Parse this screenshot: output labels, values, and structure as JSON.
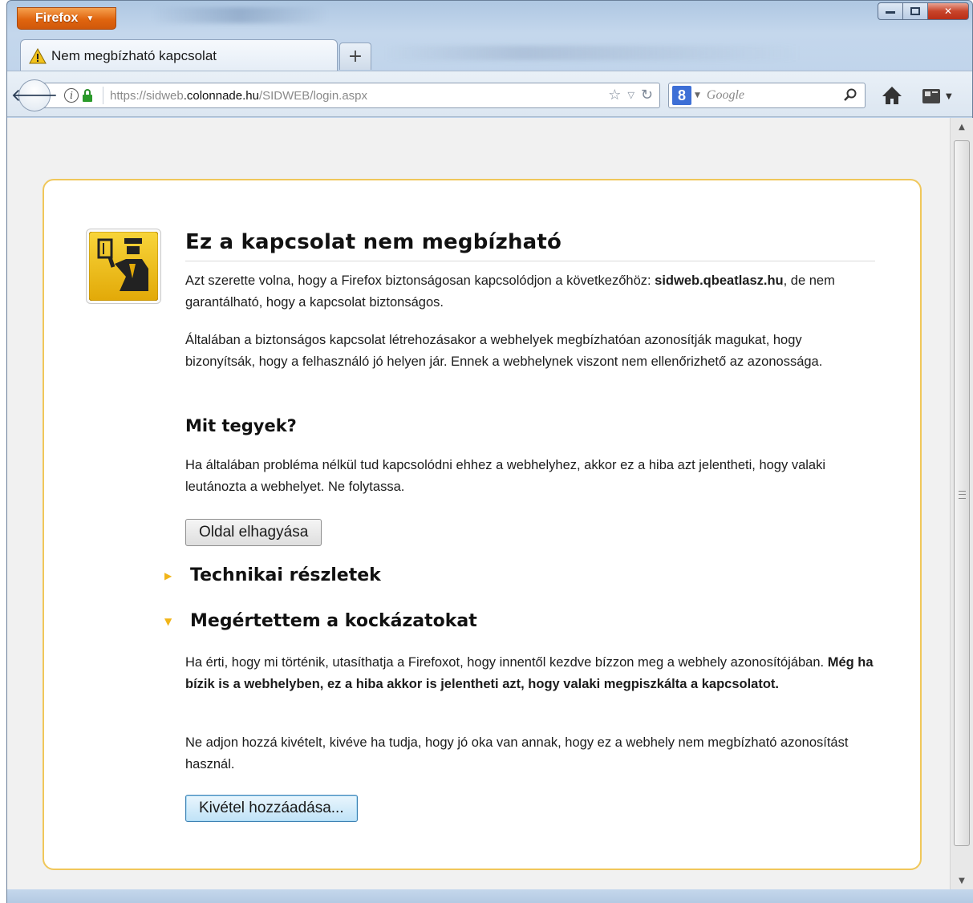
{
  "window": {
    "app_button": "Firefox",
    "colors": {
      "app_button": "#e0650f",
      "close": "#c8442a",
      "error_border": "#f0c75a",
      "expander_triangle": "#f1b519"
    }
  },
  "tabs": [
    {
      "label": "Nem megbízható kapcsolat",
      "icon": "warning-icon"
    }
  ],
  "new_tab_label": "+",
  "navbar": {
    "url_prefix": "https://sidweb",
    "url_host": ".colonnade.hu",
    "url_path": "/SIDWEB/login.aspx",
    "search_placeholder": "Google",
    "search_engine_icon": "8"
  },
  "error": {
    "title": "Ez a kapcsolat nem megbízható",
    "p1_text": "Azt szerette volna, hogy a Firefox biztonságosan kapcsolódjon a következőhöz: ",
    "p1_host": "sidweb.qbeatlasz.hu",
    "p1_tail": ", de nem garantálható, hogy a kapcsolat biztonságos.",
    "p2": "Általában a biztonságos kapcsolat létrehozásakor a webhelyek megbízhatóan azonosítják magukat, hogy bizonyítsák, hogy a felhasználó jó helyen jár. Ennek a webhelynek viszont nem ellenőrizhető az azonossága.",
    "what_to_do_heading": "Mit tegyek?",
    "p3": "Ha általában probléma nélkül tud kapcsolódni ehhez a webhelyhez, akkor ez a hiba azt jelentheti, hogy valaki leutánozta a webhelyet. Ne folytassa.",
    "leave_button": "Oldal elhagyása",
    "technical_details": "Technikai részletek",
    "understand_risks": "Megértettem a kockázatokat",
    "p4_text": "Ha érti, hogy mi történik, utasíthatja a Firefoxot, hogy innentől kezdve bízzon meg a webhely azonosítójában. ",
    "p4_bold": "Még ha bízik is a webhelyben, ez a hiba akkor is jelentheti azt, hogy valaki megpiszkálta a kapcsolatot.",
    "p5": "Ne adjon hozzá kivételt, kivéve ha tudja, hogy jó oka van annak, hogy ez a webhely nem megbízható azonosítást használ.",
    "add_exception_button": "Kivétel hozzáadása..."
  }
}
